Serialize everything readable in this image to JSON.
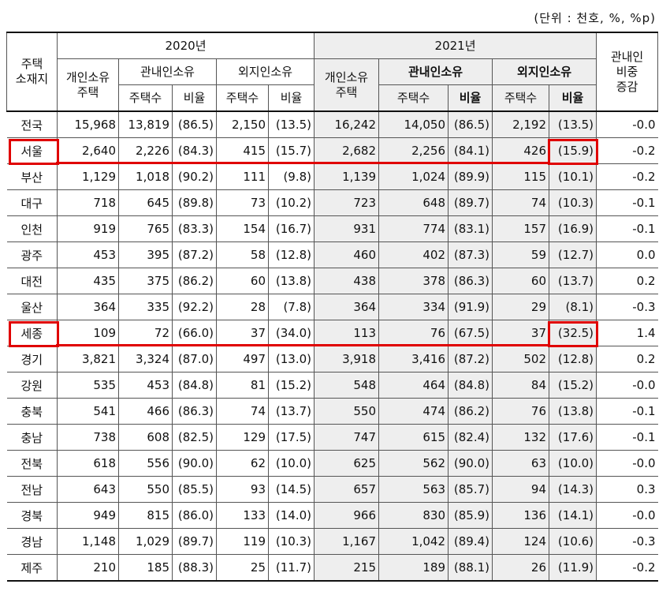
{
  "unit_note": "(단위 : 천호, %, %p)",
  "header": {
    "region": "주택\n소재지",
    "year2020": "2020년",
    "year2021": "2021년",
    "private_housing": "개인소유\n주택",
    "in_province": "관내인소유",
    "out_province": "외지인소유",
    "houses": "주택수",
    "ratio": "비율",
    "change": "관내인\n비중\n증감"
  },
  "rows": [
    [
      "전국",
      "15,968",
      "13,819",
      "(86.5)",
      "2,150",
      "(13.5)",
      "16,242",
      "14,050",
      "(86.5)",
      "2,192",
      "(13.5)",
      "-0.0"
    ],
    [
      "서울",
      "2,640",
      "2,226",
      "(84.3)",
      "415",
      "(15.7)",
      "2,682",
      "2,256",
      "(84.1)",
      "426",
      "(15.9)",
      "-0.2"
    ],
    [
      "부산",
      "1,129",
      "1,018",
      "(90.2)",
      "111",
      "(9.8)",
      "1,139",
      "1,024",
      "(89.9)",
      "115",
      "(10.1)",
      "-0.2"
    ],
    [
      "대구",
      "718",
      "645",
      "(89.8)",
      "73",
      "(10.2)",
      "723",
      "648",
      "(89.7)",
      "74",
      "(10.3)",
      "-0.1"
    ],
    [
      "인천",
      "919",
      "765",
      "(83.3)",
      "154",
      "(16.7)",
      "931",
      "774",
      "(83.1)",
      "157",
      "(16.9)",
      "-0.1"
    ],
    [
      "광주",
      "453",
      "395",
      "(87.2)",
      "58",
      "(12.8)",
      "460",
      "402",
      "(87.3)",
      "59",
      "(12.7)",
      "0.0"
    ],
    [
      "대전",
      "435",
      "375",
      "(86.2)",
      "60",
      "(13.8)",
      "438",
      "378",
      "(86.3)",
      "60",
      "(13.7)",
      "0.2"
    ],
    [
      "울산",
      "364",
      "335",
      "(92.2)",
      "28",
      "(7.8)",
      "364",
      "334",
      "(91.9)",
      "29",
      "(8.1)",
      "-0.3"
    ],
    [
      "세종",
      "109",
      "72",
      "(66.0)",
      "37",
      "(34.0)",
      "113",
      "76",
      "(67.5)",
      "37",
      "(32.5)",
      "1.4"
    ],
    [
      "경기",
      "3,821",
      "3,324",
      "(87.0)",
      "497",
      "(13.0)",
      "3,918",
      "3,416",
      "(87.2)",
      "502",
      "(12.8)",
      "0.2"
    ],
    [
      "강원",
      "535",
      "453",
      "(84.8)",
      "81",
      "(15.2)",
      "548",
      "464",
      "(84.8)",
      "84",
      "(15.2)",
      "-0.0"
    ],
    [
      "충북",
      "541",
      "466",
      "(86.3)",
      "74",
      "(13.7)",
      "550",
      "474",
      "(86.2)",
      "76",
      "(13.8)",
      "-0.1"
    ],
    [
      "충남",
      "738",
      "608",
      "(82.5)",
      "129",
      "(17.5)",
      "747",
      "615",
      "(82.4)",
      "132",
      "(17.6)",
      "-0.1"
    ],
    [
      "전북",
      "618",
      "556",
      "(90.0)",
      "62",
      "(10.0)",
      "625",
      "562",
      "(90.0)",
      "63",
      "(10.0)",
      "-0.0"
    ],
    [
      "전남",
      "643",
      "550",
      "(85.5)",
      "93",
      "(14.5)",
      "657",
      "563",
      "(85.7)",
      "94",
      "(14.3)",
      "0.3"
    ],
    [
      "경북",
      "949",
      "815",
      "(86.0)",
      "133",
      "(14.0)",
      "966",
      "830",
      "(85.9)",
      "136",
      "(14.1)",
      "-0.0"
    ],
    [
      "경남",
      "1,148",
      "1,029",
      "(89.7)",
      "119",
      "(10.3)",
      "1,167",
      "1,042",
      "(89.4)",
      "124",
      "(10.6)",
      "-0.3"
    ],
    [
      "제주",
      "210",
      "185",
      "(88.3)",
      "25",
      "(11.7)",
      "215",
      "189",
      "(88.1)",
      "26",
      "(11.9)",
      "-0.2"
    ]
  ],
  "highlight_color": "#e00000",
  "highlighted_regions": [
    "서울",
    "세종"
  ]
}
